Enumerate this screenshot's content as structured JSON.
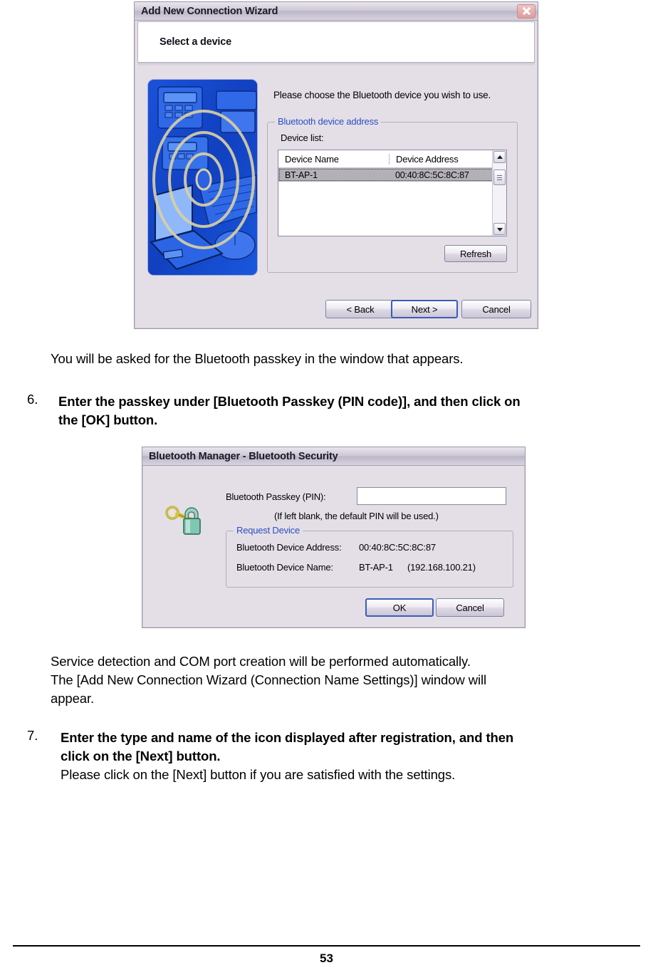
{
  "wizard_dialog": {
    "title": "Add New Connection Wizard",
    "close_icon": "close-icon",
    "header_title": "Select a device",
    "illustration_icon": "bluetooth-devices-illustration",
    "prompt": "Please choose the Bluetooth device you wish to use.",
    "group_legend": "Bluetooth device address",
    "device_list_label": "Device list:",
    "columns": [
      "Device Name",
      "Device Address"
    ],
    "rows": [
      {
        "name": "BT-AP-1",
        "address": "00:40:8C:5C:8C:87"
      }
    ],
    "refresh_label": "Refresh",
    "buttons": {
      "back": "< Back",
      "next": "Next >",
      "cancel": "Cancel"
    },
    "scrollbar": {
      "up_icon": "chevron-up-icon",
      "down_icon": "chevron-down-icon"
    }
  },
  "security_dialog": {
    "title": "Bluetooth Manager - Bluetooth Security",
    "key_icon": "key-lock-icon",
    "passkey_label": "Bluetooth Passkey (PIN):",
    "passkey_value": "",
    "hint": "(If left blank, the default PIN will be used.)",
    "group_legend": "Request Device",
    "address_label": "Bluetooth Device Address:",
    "address_value": "00:40:8C:5C:8C:87",
    "name_label": "Bluetooth Device Name:",
    "name_value": "BT-AP-1",
    "name_ip": "(192.168.100.21)",
    "buttons": {
      "ok": "OK",
      "cancel": "Cancel"
    }
  },
  "body": {
    "intro": "You will be asked for the Bluetooth passkey in the window that appears.",
    "step6_num": "6.",
    "step6_line1": "Enter the passkey under [Bluetooth Passkey (PIN code)], and then click on",
    "step6_line2": "the [OK] button.",
    "after_line1": "Service detection and COM port creation will be performed automatically.",
    "after_line2": "The [Add New Connection Wizard (Connection Name Settings)] window will",
    "after_line3": "appear.",
    "step7_num": "7.",
    "step7_line1": "Enter the type and name of the icon displayed after registration, and then",
    "step7_line2": "click on the [Next] button.",
    "step7_line3": "Please click on the [Next] button if you are satisfied with the settings."
  },
  "footer": {
    "page_number": "53"
  },
  "colors": {
    "dialog_bg": "#e4dfe6",
    "legend_blue": "#2a4fc4",
    "default_button_border": "#3a5bbd",
    "illustration_blue": "#1548c8"
  }
}
